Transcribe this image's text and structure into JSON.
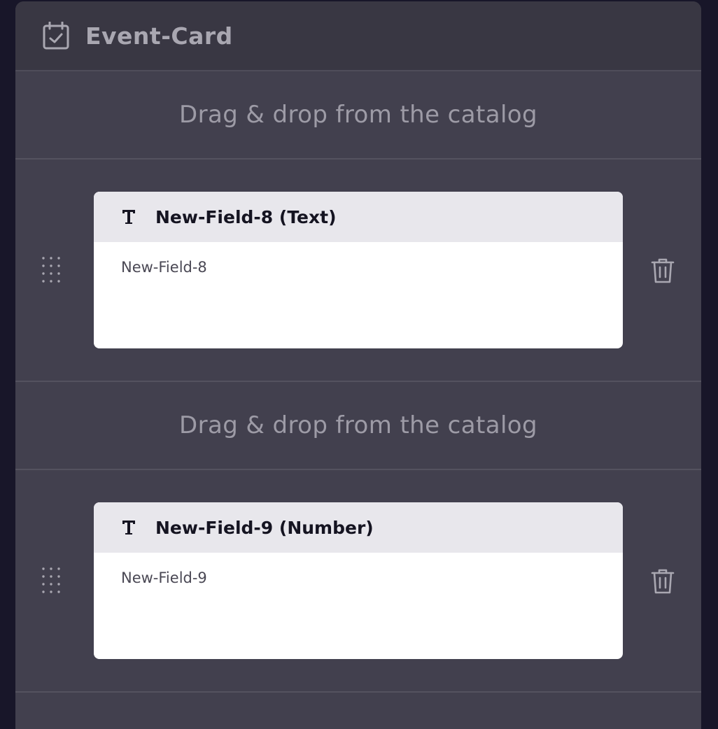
{
  "card": {
    "title": "Event-Card",
    "icon": "calendar-check-icon"
  },
  "drop_zones": [
    {
      "label": "Drag & drop from the catalog"
    },
    {
      "label": "Drag & drop from the catalog"
    }
  ],
  "fields": [
    {
      "title": "New-Field-8 (Text)",
      "value": "New-Field-8",
      "type_icon": "text-type-icon"
    },
    {
      "title": "New-Field-9 (Number)",
      "value": "New-Field-9",
      "type_icon": "text-type-icon"
    }
  ],
  "colors": {
    "background": "#181629",
    "card": "#42404e",
    "header": "#393743",
    "field_header": "#e8e7ec"
  }
}
